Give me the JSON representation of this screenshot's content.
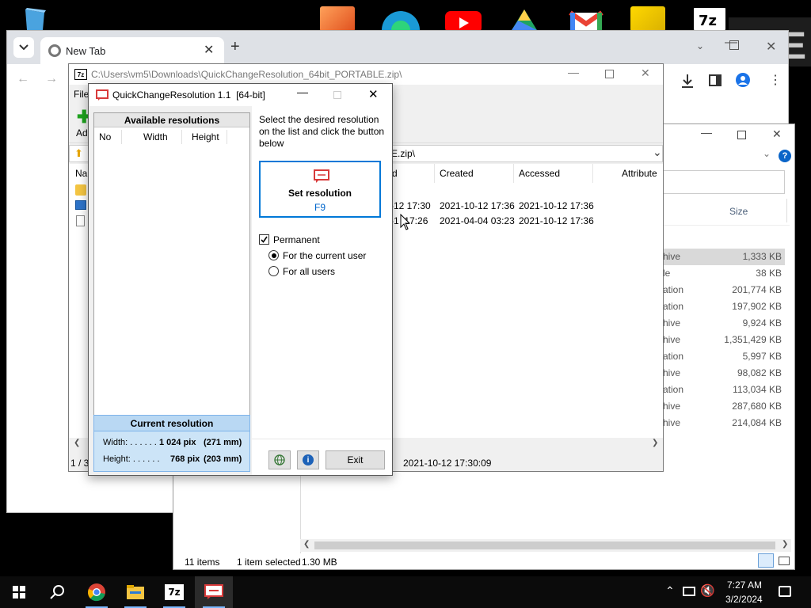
{
  "desktop": {
    "icons": [
      "recycle-bin-icon"
    ]
  },
  "top_icons": [
    "photo-editor-icon",
    "edge-icon",
    "youtube-icon",
    "google-drive-icon",
    "gmail-icon",
    "sticky-app-icon",
    "sevenzip-icon"
  ],
  "chrome": {
    "tab_label": "New Tab",
    "new_tab": "+"
  },
  "explorer": {
    "col_size": "Size",
    "rows": [
      {
        "type": "hive",
        "size": "1,333 KB"
      },
      {
        "type": "le",
        "size": "38 KB"
      },
      {
        "type": "ation",
        "size": "201,774 KB"
      },
      {
        "type": "ation",
        "size": "197,902 KB"
      },
      {
        "type": "hive",
        "size": "9,924 KB"
      },
      {
        "type": "hive",
        "size": "1,351,429 KB"
      },
      {
        "type": "ation",
        "size": "5,997 KB"
      },
      {
        "type": "hive",
        "size": "98,082 KB"
      },
      {
        "type": "ation",
        "size": "113,034 KB"
      },
      {
        "type": "hive",
        "size": "287,680 KB"
      },
      {
        "type": "hive",
        "size": "214,084 KB"
      }
    ],
    "status_items": "11 items",
    "status_selected": "1 item selected",
    "status_size": "1.30 MB"
  },
  "zip": {
    "title": "C:\\Users\\vm5\\Downloads\\QuickChangeResolution_64bit_PORTABLE.zip\\",
    "menu_file": "File",
    "add_label": "Ad",
    "path": "E.zip\\",
    "name_header": "Nar",
    "columns": {
      "modified": "d",
      "created": "Created",
      "accessed": "Accessed",
      "attributes": "Attribute"
    },
    "rows": [
      {
        "modified": "-12 17:30",
        "created": "2021-10-12 17:36",
        "accessed": "2021-10-12 17:36"
      },
      {
        "modified": "-1  17:26",
        "created": "2021-04-04 03:23",
        "accessed": "2021-10-12 17:36"
      }
    ],
    "status_left": "1 / 3",
    "status_date": "2021-10-12 17:30:09"
  },
  "qcr": {
    "title": "QuickChangeResolution 1.1  [64-bit]",
    "list_header": "Available resolutions",
    "col_no": "No",
    "col_width": "Width",
    "col_height": "Height",
    "instructions": "Select the desired resolution on the list and click the button below",
    "set_label": "Set resolution",
    "set_key": "F9",
    "permanent_label": "Permanent",
    "radio_current": "For the current user",
    "radio_all": "For all users",
    "current_header": "Current resolution",
    "width_label": "Width: . . . . . .",
    "width_value": "1 024 pix",
    "width_mm": "(271 mm)",
    "height_label": "Height: . . . . . .",
    "height_value": "768 pix",
    "height_mm": "(203 mm)",
    "exit_label": "Exit"
  },
  "taskbar": {
    "time": "7:27 AM",
    "date": "3/2/2024"
  },
  "colors": {
    "accent": "#0078d7",
    "qcr_panel": "#cce4f7",
    "red_icon": "#d83b3b"
  }
}
